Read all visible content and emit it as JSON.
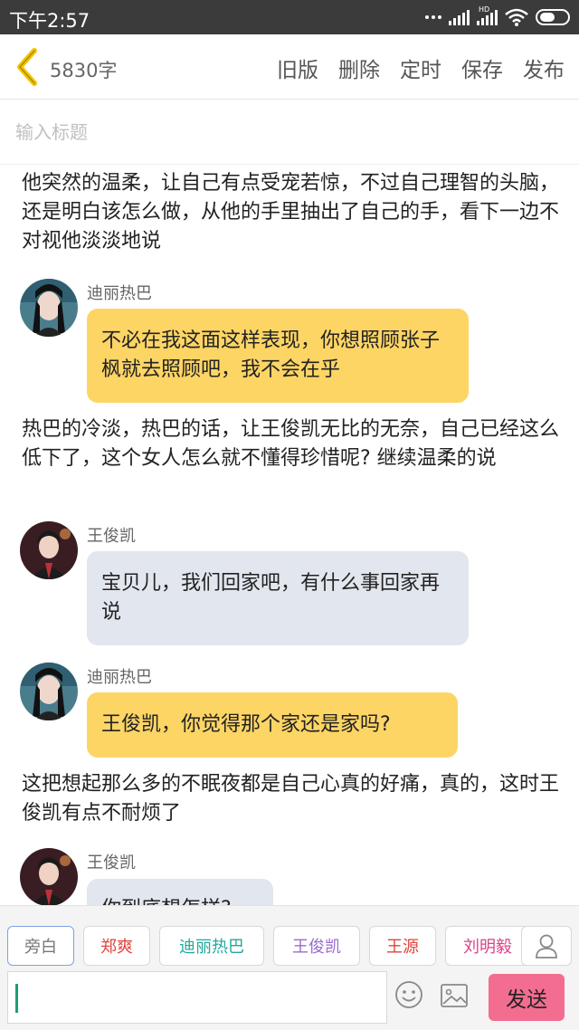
{
  "status_bar": {
    "time": "下午2:57",
    "network_label": "HD"
  },
  "toolbar": {
    "word_count": "5830字",
    "actions": [
      "旧版",
      "删除",
      "定时",
      "保存",
      "发布"
    ]
  },
  "title_input": {
    "placeholder": "输入标题",
    "value": ""
  },
  "content": {
    "narration_1": "他突然的温柔，让自己有点受宠若惊，不过自己理智的头脑，还是明白该怎么做，从他的手里抽出了自己的手，看下一边不对视他淡淡地说",
    "message_1": {
      "speaker": "迪丽热巴",
      "text": "不必在我这面这样表现，你想照顾张子枫就去照顾吧，我不会在乎"
    },
    "narration_2": "热巴的冷淡，热巴的话，让王俊凯无比的无奈，自己已经这么低下了，这个女人怎么就不懂得珍惜呢? 继续温柔的说",
    "message_2": {
      "speaker": "王俊凯",
      "text": "宝贝儿，我们回家吧，有什么事回家再说"
    },
    "message_3": {
      "speaker": "迪丽热巴",
      "text": "王俊凯，你觉得那个家还是家吗?"
    },
    "narration_3": "这把想起那么多的不眠夜都是自己心真的好痛，真的，这时王俊凯有点不耐烦了",
    "message_4": {
      "speaker": "王俊凯",
      "text": "你到底想怎样?"
    }
  },
  "characters": [
    {
      "name": "旁白",
      "color": "#777777",
      "selected": true
    },
    {
      "name": "郑爽",
      "color": "#e0453e",
      "selected": false
    },
    {
      "name": "迪丽热巴",
      "color": "#21a99a",
      "selected": false
    },
    {
      "name": "王俊凯",
      "color": "#9a6ad0",
      "selected": false
    },
    {
      "name": "王源",
      "color": "#e0453e",
      "selected": false
    },
    {
      "name": "刘明毅",
      "color": "#d8438a",
      "selected": false
    }
  ],
  "composer": {
    "input_value": "",
    "send_label": "发送"
  },
  "colors": {
    "accent_yellow": "#fdd565",
    "bubble_gray": "#e2e6ee",
    "send_pink": "#f36d91",
    "back_yellow": "#f2c200"
  }
}
